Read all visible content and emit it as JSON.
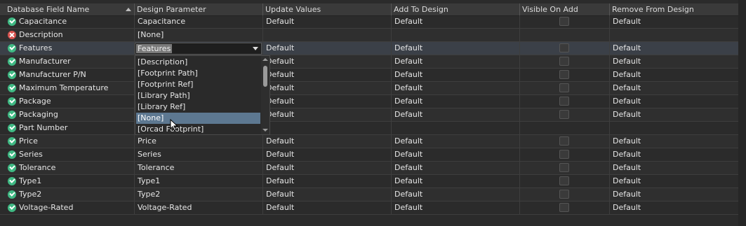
{
  "columns": [
    "Database Field Name",
    "Design Parameter",
    "Update Values",
    "Add To Design",
    "Visible On Add",
    "Remove From Design"
  ],
  "rows": [
    {
      "field": "Capacitance",
      "status": "ok",
      "param": "Capacitance",
      "update": "Default",
      "add": "Default",
      "visible": false,
      "remove": "Default"
    },
    {
      "field": "Description",
      "status": "error",
      "param": "[None]",
      "update": "",
      "add": "",
      "visible": null,
      "remove": ""
    },
    {
      "field": "Features",
      "status": "ok",
      "param": "Features",
      "update": "Default",
      "add": "Default",
      "visible": false,
      "remove": "Default"
    },
    {
      "field": "Manufacturer",
      "status": "ok",
      "param": "",
      "update": "Default",
      "add": "Default",
      "visible": false,
      "remove": "Default"
    },
    {
      "field": "Manufacturer P/N",
      "status": "ok",
      "param": "",
      "update": "Default",
      "add": "Default",
      "visible": false,
      "remove": "Default"
    },
    {
      "field": "Maximum Temperature",
      "status": "ok",
      "param": "",
      "update": "Default",
      "add": "Default",
      "visible": false,
      "remove": "Default"
    },
    {
      "field": "Package",
      "status": "ok",
      "param": "",
      "update": "Default",
      "add": "Default",
      "visible": false,
      "remove": "Default"
    },
    {
      "field": "Packaging",
      "status": "ok",
      "param": "",
      "update": "Default",
      "add": "Default",
      "visible": false,
      "remove": "Default"
    },
    {
      "field": "Part Number",
      "status": "ok",
      "param": "",
      "update": "",
      "add": "",
      "visible": null,
      "remove": ""
    },
    {
      "field": "Price",
      "status": "ok",
      "param": "Price",
      "update": "Default",
      "add": "Default",
      "visible": false,
      "remove": "Default"
    },
    {
      "field": "Series",
      "status": "ok",
      "param": "Series",
      "update": "Default",
      "add": "Default",
      "visible": false,
      "remove": "Default"
    },
    {
      "field": "Tolerance",
      "status": "ok",
      "param": "Tolerance",
      "update": "Default",
      "add": "Default",
      "visible": false,
      "remove": "Default"
    },
    {
      "field": "Type1",
      "status": "ok",
      "param": "Type1",
      "update": "Default",
      "add": "Default",
      "visible": false,
      "remove": "Default"
    },
    {
      "field": "Type2",
      "status": "ok",
      "param": "Type2",
      "update": "Default",
      "add": "Default",
      "visible": false,
      "remove": "Default"
    },
    {
      "field": "Voltage-Rated",
      "status": "ok",
      "param": "Voltage-Rated",
      "update": "Default",
      "add": "Default",
      "visible": false,
      "remove": "Default"
    }
  ],
  "editor": {
    "value": "Features",
    "options": [
      "[Description]",
      "[Footprint Path]",
      "[Footprint Ref]",
      "[Library Path]",
      "[Library Ref]",
      "[None]",
      "[Orcad Footprint]"
    ],
    "highlighted": "[None]"
  },
  "colors": {
    "ok": "#3fb983",
    "error": "#d9534f",
    "highlight": "#5d7891"
  }
}
